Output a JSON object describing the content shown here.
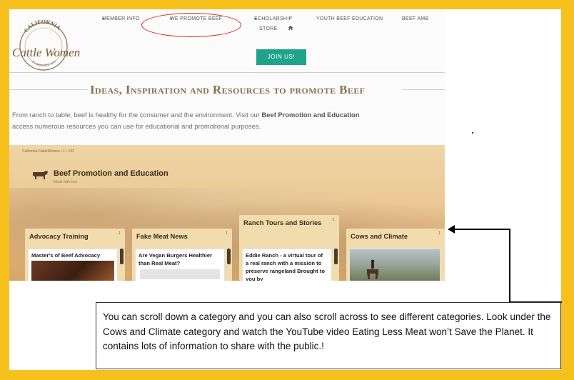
{
  "colors": {
    "frame": "#f6c11d",
    "accent_green": "#1fa38a",
    "heading_brown": "#8c6e4d",
    "highlight_red": "#d9261c"
  },
  "logo": {
    "top_text": "CALIFORNIA",
    "main_text": "Cattle Women",
    "bottom_text": "ESTABLISHED 1931"
  },
  "nav": {
    "items": [
      {
        "label": "MEMBER INFO",
        "caret": "▾"
      },
      {
        "label": "WE PROMOTE BEEF",
        "caret": "▾"
      },
      {
        "label": "SCHOLARSHIP",
        "caret": "▾"
      },
      {
        "label": "YOUTH BEEF EDUCATION",
        "caret": ""
      },
      {
        "label": "BEEF AMB",
        "caret": ""
      }
    ],
    "store": "STORE",
    "home_icon": "home-icon"
  },
  "join_button": "JOIN US!",
  "heading": "Ideas, Inspiration and Resources to promote Beef",
  "paragraph": {
    "line1_start": "From ranch to table, beef is healthy for the consumer and the environment.  Visit our ",
    "line1_bold": "Beef Promotion and Education",
    "line2": "access numerous resources you can use for educational and promotional purposes."
  },
  "board": {
    "crumb": "California CattleWomen  •  1  •  132",
    "title": "Beef Promotion and Education",
    "subtitle": "Made with love",
    "columns": [
      {
        "title": "Advocacy Training",
        "count": "1",
        "card": "Master's of Beef Advocacy"
      },
      {
        "title": "Fake Meat News",
        "count": "1",
        "card": "Are Vegan Burgers Healthier than Real Meat?"
      },
      {
        "title": "Ranch Tours and Stories",
        "count": "1",
        "card": "Eddie Ranch - a virtual tour of a real ranch with a mission to preserve rangeland Brought to you by"
      },
      {
        "title": "Cows and Climate",
        "count": "1",
        "card": ""
      }
    ]
  },
  "callout": "You can scroll down a category and you can also scroll across to see different categories. Look under the Cows and Climate category and watch the YouTube video Eating Less Meat won’t Save the Planet.  It contains lots of information to share with the public.!"
}
